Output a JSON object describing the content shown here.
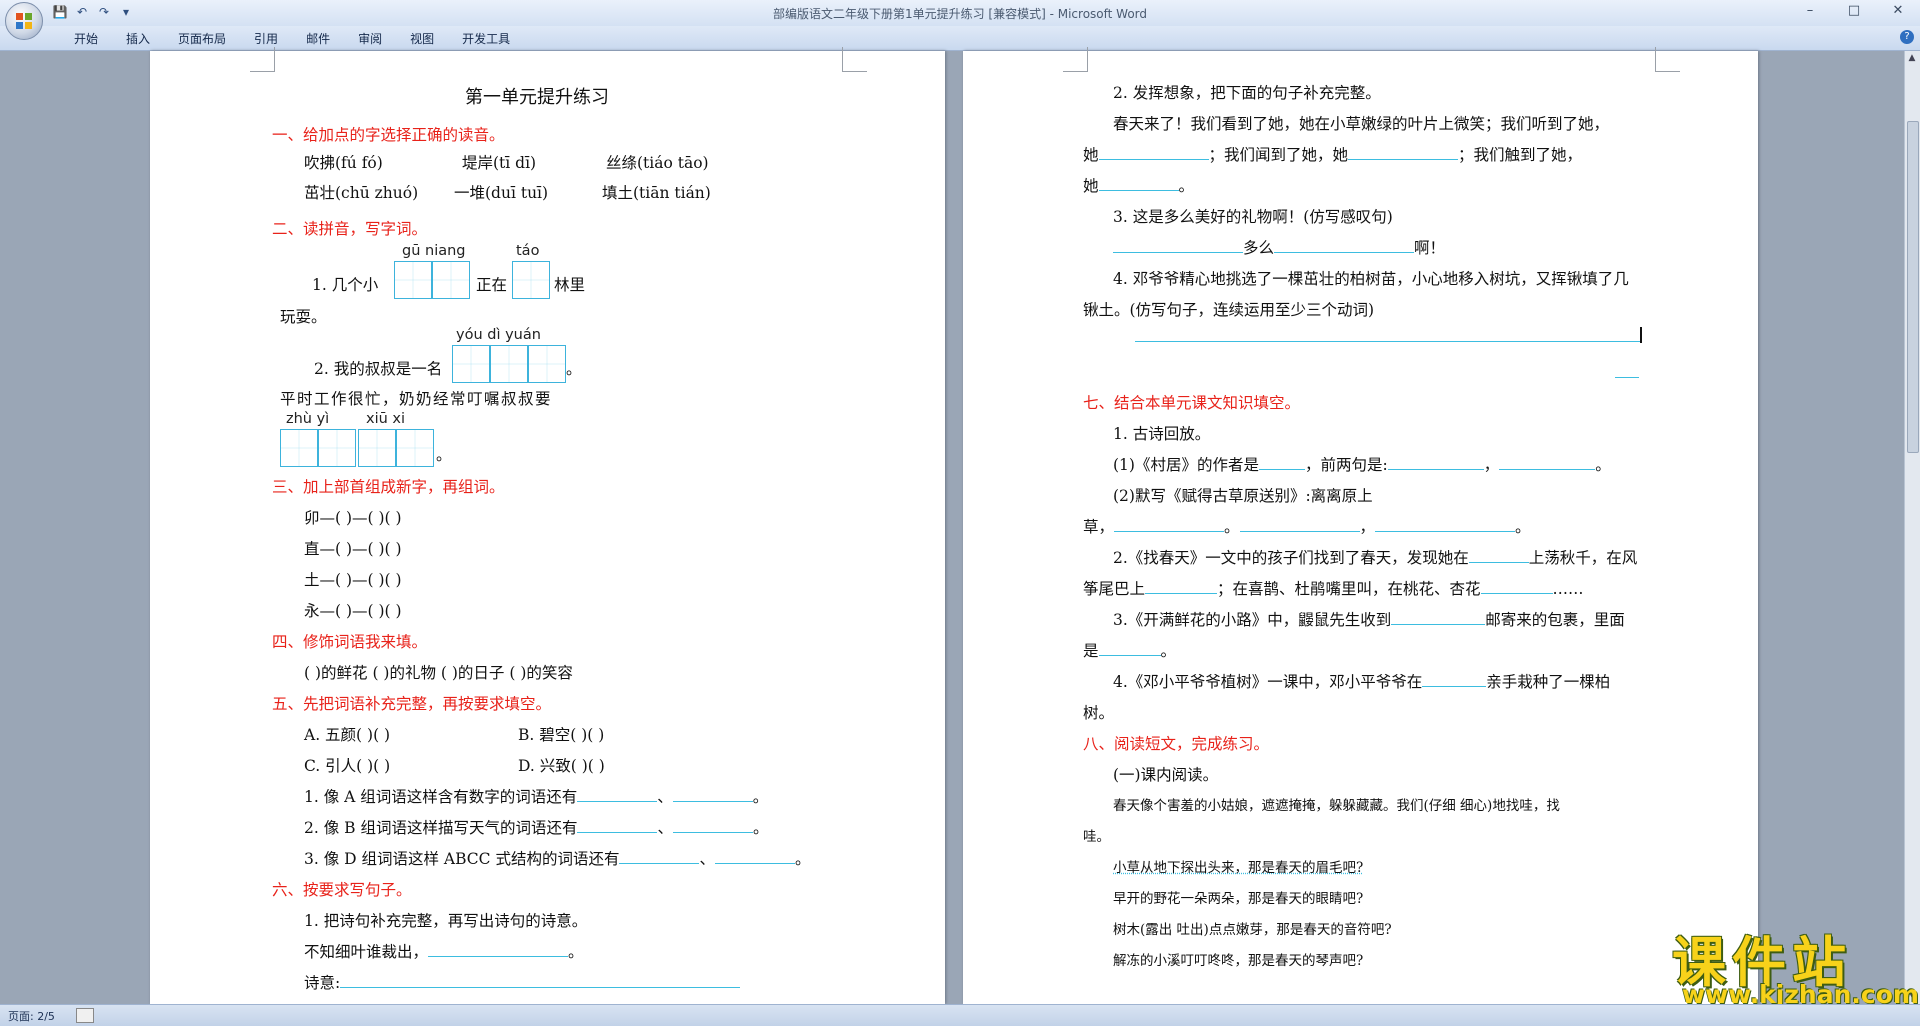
{
  "window": {
    "title": "部编版语文二年级下册第1单元提升练习 [兼容模式] - Microsoft Word",
    "controls": [
      "–",
      "□",
      "✕"
    ]
  },
  "ribbon": {
    "tabs": [
      "开始",
      "插入",
      "页面布局",
      "引用",
      "邮件",
      "审阅",
      "视图",
      "开发工具"
    ]
  },
  "status": {
    "page": "页面: 2/5"
  },
  "watermark": {
    "brand": "课件站",
    "url": "www.kjzhan.com"
  },
  "left_page": {
    "title": "第一单元提升练习",
    "s1": {
      "heading": "一、给加点的字选择正确的读音。",
      "row1": [
        "吹拂(fú  fó)",
        "堤岸(tī  dī)",
        "丝绦(tiáo  tāo)"
      ],
      "row2": [
        "茁壮(chū  zhuó)",
        "一堆(duī  tuī)",
        "填土(tiān  tián)"
      ]
    },
    "s2": {
      "heading": "二、读拼音，写字词。",
      "q1_pinyin_a": "gū niang",
      "q1_pinyin_b": "táo",
      "q1_pre": "1. 几个小",
      "q1_mid": "正在",
      "q1_post": "林里",
      "q1_cont": "玩耍。",
      "q2_pinyin": "yóu  dì  yuán",
      "q2_pre": "2. 我的叔叔是一名",
      "q2_post": "。",
      "q2_cont": "平时工作很忙，奶奶经常叮嘱叔叔要",
      "q2_pinyin2a": "zhù  yì",
      "q2_pinyin2b": "xiū  xi",
      "q2_end": "。"
    },
    "s3": {
      "heading": "三、加上部首组成新字，再组词。",
      "rows": [
        "卯—(    )—(    )(    )",
        "直—(    )—(    )(    )",
        "土—(    )—(    )(    )",
        "永—(    )—(    )(    )"
      ]
    },
    "s4": {
      "heading": "四、修饰词语我来填。",
      "line": "(    )的鲜花    (    )的礼物    (    )的日子    (    )的笑容"
    },
    "s5": {
      "heading": "五、先把词语补充完整，再按要求填空。",
      "a": "A. 五颜(    )(    )",
      "b": "B. 碧空(    )(    )",
      "c": "C. 引人(    )(    )",
      "d": "D. 兴致(    )(    )",
      "q1": "1. 像 A 组词语这样含有数字的词语还有",
      "q2": "2. 像 B 组词语这样描写天气的词语还有",
      "q3": "3. 像 D 组词语这样 ABCC 式结构的词语还有",
      "sep": "、",
      "end": "。"
    },
    "s6": {
      "heading": "六、按要求写句子。",
      "q1": "1. 把诗句补充完整，再写出诗句的诗意。",
      "poem": "不知细叶谁裁出，",
      "meaning": "诗意:"
    }
  },
  "right_page": {
    "q2": "2. 发挥想象，把下面的句子补充完整。",
    "q2_l1": "春天来了！我们看到了她，她在小草嫩绿的叶片上微笑；我们听到了她，",
    "q2_l2a": "她",
    "q2_l2b": "；我们闻到了她，她",
    "q2_l2c": "；我们触到了她，",
    "q2_l3": "她",
    "q3": "3. 这是多么美好的礼物啊！(仿写感叹句)",
    "q3_mid": "多么",
    "q3_end": "啊！",
    "q4_l1": "4. 邓爷爷精心地挑选了一棵茁壮的柏树苗，小心地移入树坑，又挥锹填了几",
    "q4_l2": "锹土。(仿写句子，连续运用至少三个动词)",
    "s7": {
      "heading": "七、结合本单元课文知识填空。",
      "p1": "1. 古诗回放。",
      "p1a_pre": "(1)《村居》的作者是",
      "p1a_mid": "，前两句是:",
      "p1b": "(2)默写《赋得古草原送别》:离离原上",
      "p1b_cont": "草，",
      "p2_l1a": "2.《找春天》一文中的孩子们找到了春天，发现她在",
      "p2_l1b": "上荡秋千，在风",
      "p2_l2a": "筝尾巴上",
      "p2_l2b": "；在喜鹊、杜鹃嘴里叫，在桃花、杏花",
      "p2_l2c": "……",
      "p3_l1a": "3.《开满鲜花的小路》中，鼹鼠先生收到",
      "p3_l1b": "邮寄来的包裹，里面",
      "p3_l2": "是",
      "p4_l1a": "4.《邓小平爷爷植树》一课中，邓小平爷爷在",
      "p4_l1b": "亲手栽种了一棵柏",
      "p4_l2": "树。"
    },
    "s8": {
      "heading": "八、阅读短文，完成练习。",
      "sub": "(一)课内阅读。",
      "r1": "春天像个害羞的小姑娘，遮遮掩掩，躲躲藏藏。我们(仔细  细心)地找哇，找",
      "r1b": "哇。",
      "r2": "小草从地下探出头来，那是春天的眉毛吧?",
      "r3": "早开的野花一朵两朵，那是春天的眼睛吧?",
      "r4": "树木(露出  吐出)点点嫩芽，那是春天的音符吧?",
      "r5": "解冻的小溪叮叮咚咚，那是春天的琴声吧?"
    }
  }
}
